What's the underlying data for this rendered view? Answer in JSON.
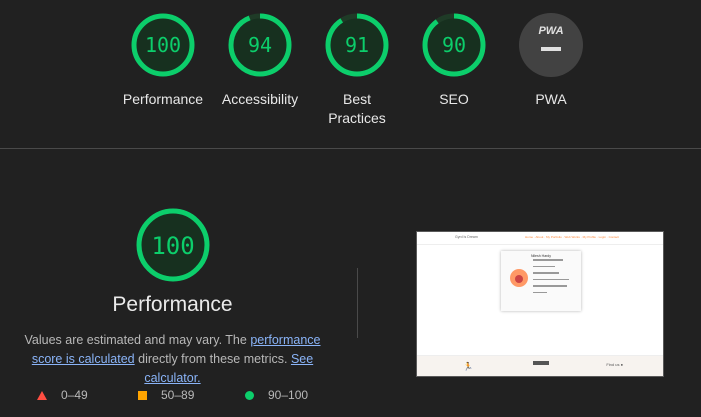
{
  "summary": {
    "gauges": [
      {
        "label": "Performance",
        "score": "100",
        "color": "#0cce6b"
      },
      {
        "label": "Accessibility",
        "score": "94",
        "color": "#0cce6b"
      },
      {
        "label": "Best\nPractices",
        "score": "91",
        "color": "#0cce6b"
      },
      {
        "label": "SEO",
        "score": "90",
        "color": "#0cce6b"
      },
      {
        "label": "PWA",
        "score": "",
        "icon": "pwa-icon",
        "color": "#9e9e9e"
      }
    ],
    "pwa_badge_text": "PWA"
  },
  "performance": {
    "score": "100",
    "title": "Performance",
    "note_prefix": "Values are estimated and may vary. The ",
    "note_link1": "performance score is calculated",
    "note_middle": " directly from these metrics. ",
    "note_link2": "See calculator."
  },
  "legend": [
    {
      "shape": "triangle",
      "label": "0–49",
      "color": "#ff4e42"
    },
    {
      "shape": "square",
      "label": "50–89",
      "color": "#ffa400"
    },
    {
      "shape": "circle",
      "label": "90–100",
      "color": "#0cce6b"
    }
  ],
  "thumbnail": {
    "brand": "Gyrd Is Dream",
    "nav": "Home · About · My Portfolio · Web Works · My Profile · Login · Contact",
    "card_title": "Nilesh Hardy",
    "footer_right": "Find us ●"
  }
}
